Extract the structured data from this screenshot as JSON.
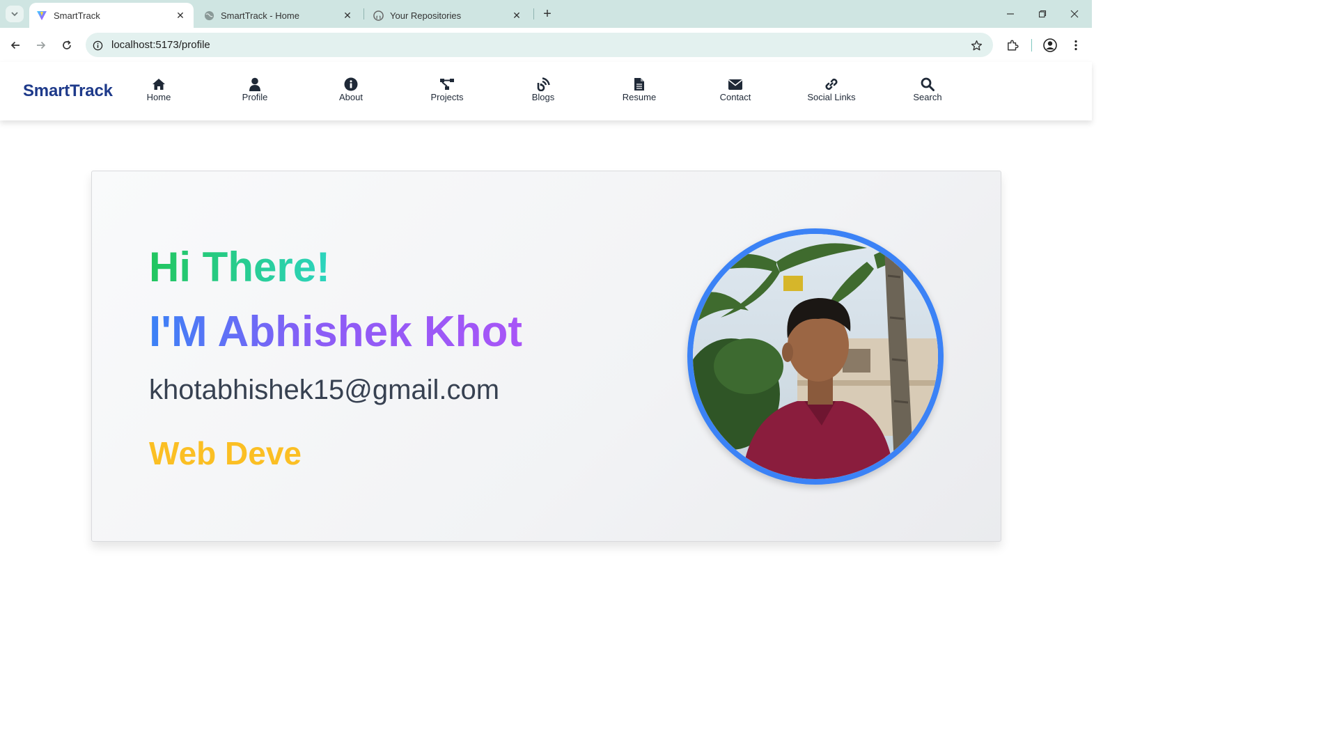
{
  "browser": {
    "tabs": [
      {
        "title": "SmartTrack",
        "icon": "vite-logo-icon",
        "active": true
      },
      {
        "title": "SmartTrack - Home",
        "icon": "globe-icon",
        "active": false
      },
      {
        "title": "Your Repositories",
        "icon": "github-icon",
        "active": false
      }
    ],
    "url": "localhost:5173/profile"
  },
  "app": {
    "brand": "SmartTrack",
    "nav": [
      {
        "label": "Home",
        "icon": "home-icon"
      },
      {
        "label": "Profile",
        "icon": "user-icon"
      },
      {
        "label": "About",
        "icon": "info-icon"
      },
      {
        "label": "Projects",
        "icon": "project-diagram-icon"
      },
      {
        "label": "Blogs",
        "icon": "blog-icon"
      },
      {
        "label": "Resume",
        "icon": "file-icon"
      },
      {
        "label": "Contact",
        "icon": "envelope-icon"
      },
      {
        "label": "Social Links",
        "icon": "link-icon"
      },
      {
        "label": "Search",
        "icon": "search-icon"
      }
    ]
  },
  "profile": {
    "greeting": "Hi There!",
    "name": "I'M Abhishek Khot",
    "email": "khotabhishek15@gmail.com",
    "role": "Web Deve",
    "avatar_icon": "profile-photo"
  },
  "colors": {
    "brand": "#1e3a8a",
    "greeting_gradient": [
      "#22c55e",
      "#2dd4bf"
    ],
    "name_gradient": [
      "#3b82f6",
      "#a855f7"
    ],
    "role": "#fbbf24",
    "avatar_border": "#3b82f6",
    "tab_strip": "#cfe5e2"
  }
}
